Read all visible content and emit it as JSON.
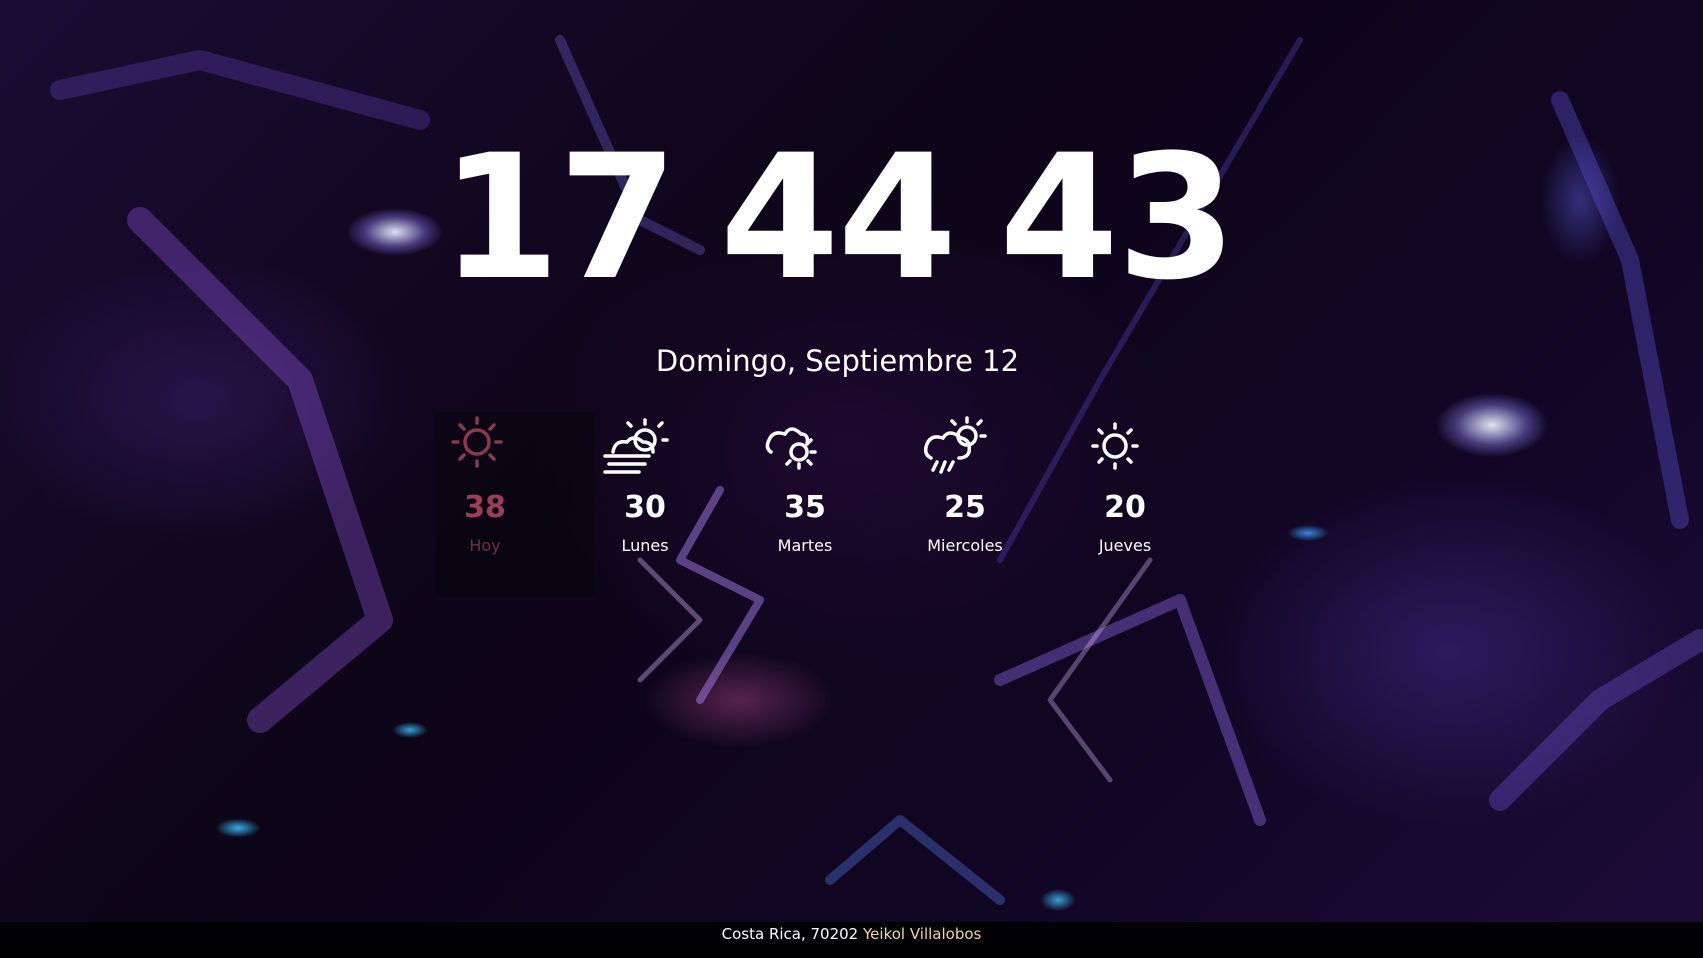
{
  "clock": {
    "hours": "17",
    "minutes": "44",
    "seconds": "43"
  },
  "date": "Domingo, Septiembre 12",
  "forecast": [
    {
      "label": "Hoy",
      "temp": "38",
      "icon": "sun-icon",
      "active": true
    },
    {
      "label": "Lunes",
      "temp": "30",
      "icon": "sun-cloud-wind-icon",
      "active": false
    },
    {
      "label": "Martes",
      "temp": "35",
      "icon": "cloud-sun-icon",
      "active": false
    },
    {
      "label": "Miercoles",
      "temp": "25",
      "icon": "cloud-rain-sun-icon",
      "active": false
    },
    {
      "label": "Jueves",
      "temp": "20",
      "icon": "sun-icon",
      "active": false
    }
  ],
  "footer": {
    "location": "Costa Rica, 70202",
    "author": "Yeikol Villalobos"
  },
  "colors": {
    "active_temp": "#9a3f55",
    "author": "#f0d79a",
    "footer_bg": "#020103"
  }
}
